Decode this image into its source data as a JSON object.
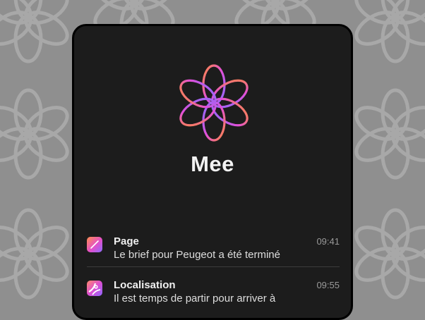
{
  "app": {
    "name": "Mee"
  },
  "colors": {
    "background": "#8f8f8f",
    "pattern": "#a8a8a8",
    "screen": "#1c1c1c",
    "logo_gradient": [
      "#ff8a3d",
      "#e24fd8",
      "#8a6cff"
    ]
  },
  "notifications": [
    {
      "icon": "page-icon",
      "title": "Page",
      "body": "Le brief pour Peugeot a été terminé",
      "time": "09:41"
    },
    {
      "icon": "map-icon",
      "title": "Localisation",
      "body": "Il est temps de partir pour arriver à",
      "time": "09:55"
    }
  ]
}
